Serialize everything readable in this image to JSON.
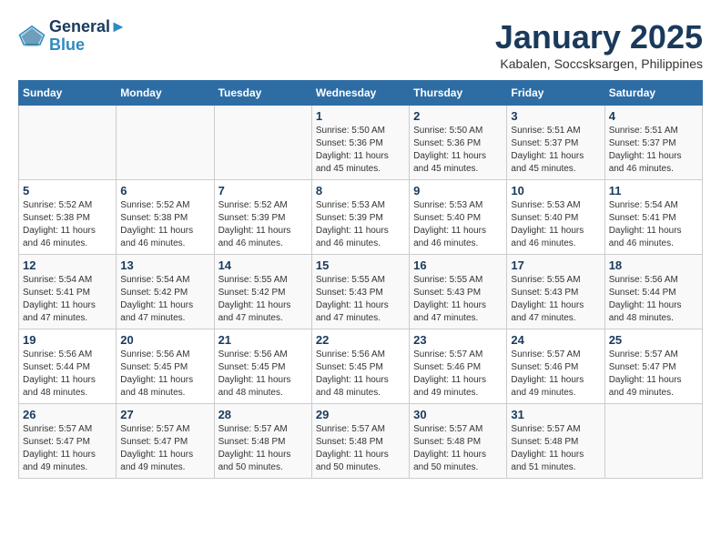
{
  "header": {
    "logo_line1": "General",
    "logo_line2": "Blue",
    "month_title": "January 2025",
    "subtitle": "Kabalen, Soccsksargen, Philippines"
  },
  "days_of_week": [
    "Sunday",
    "Monday",
    "Tuesday",
    "Wednesday",
    "Thursday",
    "Friday",
    "Saturday"
  ],
  "weeks": [
    [
      {
        "day": "",
        "info": ""
      },
      {
        "day": "",
        "info": ""
      },
      {
        "day": "",
        "info": ""
      },
      {
        "day": "1",
        "info": "Sunrise: 5:50 AM\nSunset: 5:36 PM\nDaylight: 11 hours and 45 minutes."
      },
      {
        "day": "2",
        "info": "Sunrise: 5:50 AM\nSunset: 5:36 PM\nDaylight: 11 hours and 45 minutes."
      },
      {
        "day": "3",
        "info": "Sunrise: 5:51 AM\nSunset: 5:37 PM\nDaylight: 11 hours and 45 minutes."
      },
      {
        "day": "4",
        "info": "Sunrise: 5:51 AM\nSunset: 5:37 PM\nDaylight: 11 hours and 46 minutes."
      }
    ],
    [
      {
        "day": "5",
        "info": "Sunrise: 5:52 AM\nSunset: 5:38 PM\nDaylight: 11 hours and 46 minutes."
      },
      {
        "day": "6",
        "info": "Sunrise: 5:52 AM\nSunset: 5:38 PM\nDaylight: 11 hours and 46 minutes."
      },
      {
        "day": "7",
        "info": "Sunrise: 5:52 AM\nSunset: 5:39 PM\nDaylight: 11 hours and 46 minutes."
      },
      {
        "day": "8",
        "info": "Sunrise: 5:53 AM\nSunset: 5:39 PM\nDaylight: 11 hours and 46 minutes."
      },
      {
        "day": "9",
        "info": "Sunrise: 5:53 AM\nSunset: 5:40 PM\nDaylight: 11 hours and 46 minutes."
      },
      {
        "day": "10",
        "info": "Sunrise: 5:53 AM\nSunset: 5:40 PM\nDaylight: 11 hours and 46 minutes."
      },
      {
        "day": "11",
        "info": "Sunrise: 5:54 AM\nSunset: 5:41 PM\nDaylight: 11 hours and 46 minutes."
      }
    ],
    [
      {
        "day": "12",
        "info": "Sunrise: 5:54 AM\nSunset: 5:41 PM\nDaylight: 11 hours and 47 minutes."
      },
      {
        "day": "13",
        "info": "Sunrise: 5:54 AM\nSunset: 5:42 PM\nDaylight: 11 hours and 47 minutes."
      },
      {
        "day": "14",
        "info": "Sunrise: 5:55 AM\nSunset: 5:42 PM\nDaylight: 11 hours and 47 minutes."
      },
      {
        "day": "15",
        "info": "Sunrise: 5:55 AM\nSunset: 5:43 PM\nDaylight: 11 hours and 47 minutes."
      },
      {
        "day": "16",
        "info": "Sunrise: 5:55 AM\nSunset: 5:43 PM\nDaylight: 11 hours and 47 minutes."
      },
      {
        "day": "17",
        "info": "Sunrise: 5:55 AM\nSunset: 5:43 PM\nDaylight: 11 hours and 47 minutes."
      },
      {
        "day": "18",
        "info": "Sunrise: 5:56 AM\nSunset: 5:44 PM\nDaylight: 11 hours and 48 minutes."
      }
    ],
    [
      {
        "day": "19",
        "info": "Sunrise: 5:56 AM\nSunset: 5:44 PM\nDaylight: 11 hours and 48 minutes."
      },
      {
        "day": "20",
        "info": "Sunrise: 5:56 AM\nSunset: 5:45 PM\nDaylight: 11 hours and 48 minutes."
      },
      {
        "day": "21",
        "info": "Sunrise: 5:56 AM\nSunset: 5:45 PM\nDaylight: 11 hours and 48 minutes."
      },
      {
        "day": "22",
        "info": "Sunrise: 5:56 AM\nSunset: 5:45 PM\nDaylight: 11 hours and 48 minutes."
      },
      {
        "day": "23",
        "info": "Sunrise: 5:57 AM\nSunset: 5:46 PM\nDaylight: 11 hours and 49 minutes."
      },
      {
        "day": "24",
        "info": "Sunrise: 5:57 AM\nSunset: 5:46 PM\nDaylight: 11 hours and 49 minutes."
      },
      {
        "day": "25",
        "info": "Sunrise: 5:57 AM\nSunset: 5:47 PM\nDaylight: 11 hours and 49 minutes."
      }
    ],
    [
      {
        "day": "26",
        "info": "Sunrise: 5:57 AM\nSunset: 5:47 PM\nDaylight: 11 hours and 49 minutes."
      },
      {
        "day": "27",
        "info": "Sunrise: 5:57 AM\nSunset: 5:47 PM\nDaylight: 11 hours and 49 minutes."
      },
      {
        "day": "28",
        "info": "Sunrise: 5:57 AM\nSunset: 5:48 PM\nDaylight: 11 hours and 50 minutes."
      },
      {
        "day": "29",
        "info": "Sunrise: 5:57 AM\nSunset: 5:48 PM\nDaylight: 11 hours and 50 minutes."
      },
      {
        "day": "30",
        "info": "Sunrise: 5:57 AM\nSunset: 5:48 PM\nDaylight: 11 hours and 50 minutes."
      },
      {
        "day": "31",
        "info": "Sunrise: 5:57 AM\nSunset: 5:48 PM\nDaylight: 11 hours and 51 minutes."
      },
      {
        "day": "",
        "info": ""
      }
    ]
  ]
}
